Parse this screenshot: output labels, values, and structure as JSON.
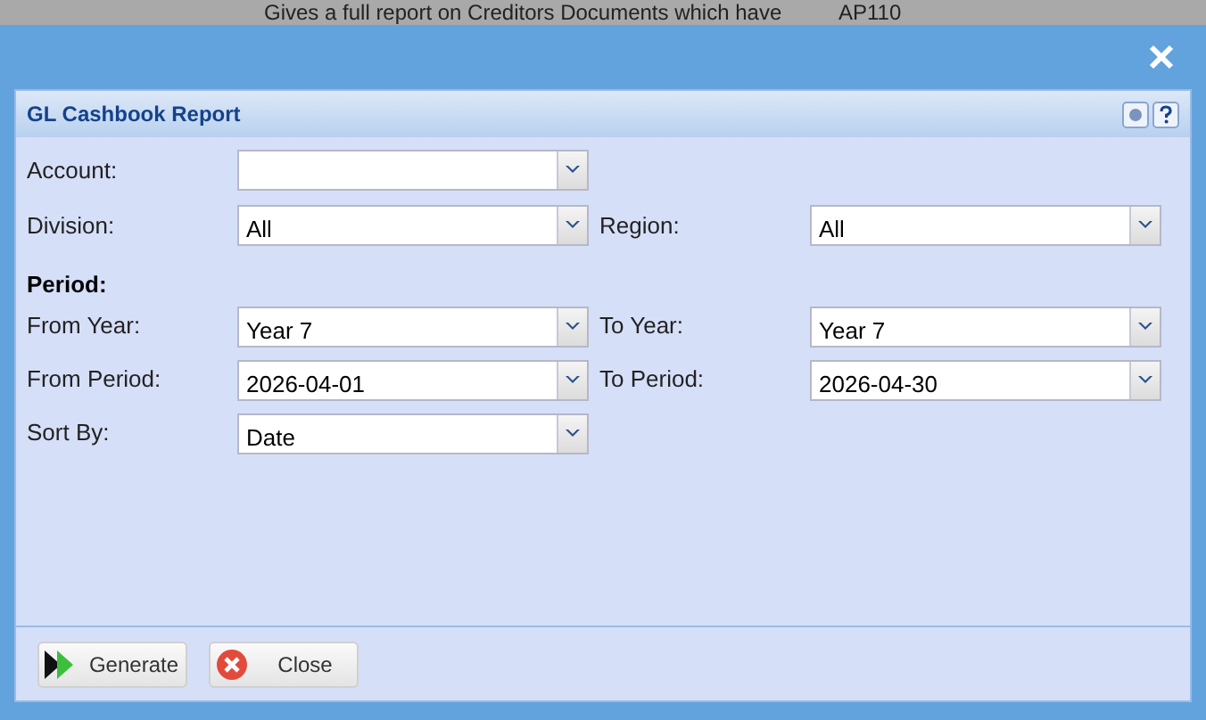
{
  "background": {
    "description": "Gives a full report on Creditors Documents which have",
    "code": "AP110"
  },
  "window": {
    "title": "GL Cashbook Report"
  },
  "fields": [
    {
      "label": "Account:"
    },
    {
      "label": "Division:",
      "value": "All",
      "label_2": "Region:",
      "value_2": "All"
    }
  ],
  "section": "Period:",
  "period_fields": [
    {
      "label": "From Year:",
      "value": "Year 7",
      "label_2": "To Year:",
      "value_2": "Year 7"
    },
    {
      "label": "From Period:",
      "value": "2026-04-01",
      "label_2": "To Period:",
      "value_2": "2026-04-30"
    },
    {
      "label": "Sort By:",
      "value": "Date"
    }
  ],
  "buttons": [
    {
      "label": "Generate",
      "kind": "generate"
    },
    {
      "label": "Close",
      "kind": "close"
    }
  ]
}
